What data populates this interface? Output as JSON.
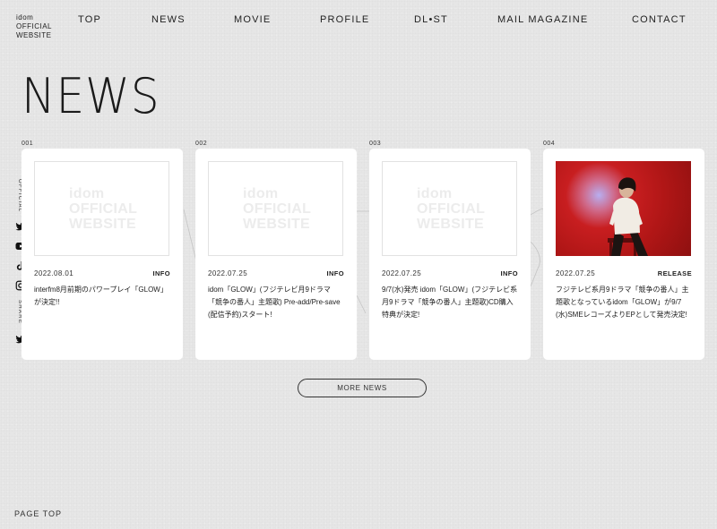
{
  "logo": [
    "idom",
    "OFFICIAL",
    "WEBSITE"
  ],
  "nav": [
    "TOP",
    "NEWS",
    "MOVIE",
    "PROFILE",
    "DL•ST",
    "MAIL MAGAZINE",
    "CONTACT"
  ],
  "heading": "NEWS",
  "sidebar": {
    "official_label": "OFFICIAL",
    "share_label": "SHARE",
    "official_icons": [
      "twitter-icon",
      "youtube-icon",
      "tiktok-icon",
      "instagram-icon"
    ],
    "share_icons": [
      "twitter-icon"
    ]
  },
  "placeholder": [
    "idom",
    "OFFICIAL",
    "WEBSITE"
  ],
  "cards": [
    {
      "num": "001",
      "date": "2022.08.01",
      "category": "INFO",
      "text": "interfm8月前期のパワープレイ「GLOW」が決定!!",
      "image": "placeholder"
    },
    {
      "num": "002",
      "date": "2022.07.25",
      "category": "INFO",
      "text": "idom「GLOW」(フジテレビ月9ドラマ「競争の番人」主題歌) Pre-add/Pre-save(配信予約)スタート!",
      "image": "placeholder"
    },
    {
      "num": "003",
      "date": "2022.07.25",
      "category": "INFO",
      "text": "9/7(水)発売 idom「GLOW」(フジテレビ系月9ドラマ「競争の番人」主題歌)CD購入特典が決定!",
      "image": "placeholder"
    },
    {
      "num": "004",
      "date": "2022.07.25",
      "category": "RELEASE",
      "text": "フジテレビ系月9ドラマ「競争の番人」主題歌となっているidom「GLOW」が9/7(水)SMEレコーズよりEPとして発売決定!",
      "image": "photo"
    }
  ],
  "more_button": "MORE NEWS",
  "page_top": "PAGE TOP"
}
